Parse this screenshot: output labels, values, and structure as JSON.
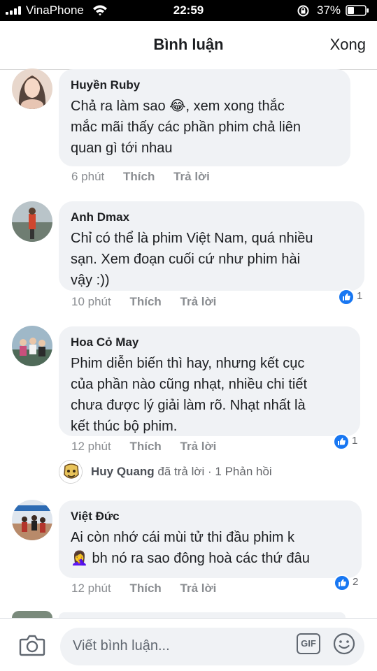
{
  "status_bar": {
    "carrier": "VinaPhone",
    "time": "22:59",
    "battery": "37%"
  },
  "header": {
    "title": "Bình luận",
    "done_label": "Xong"
  },
  "comments": [
    {
      "author": "Huyền Ruby",
      "text_before_emoji": "Chả ra làm sao ",
      "emoji": "😂",
      "text_after_emoji": ", xem xong thắc\nmắc mãi thấy các phần phim chả liên\nquan gì tới nhau",
      "time": "6 phút",
      "like_label": "Thích",
      "reply_label": "Trả lời"
    },
    {
      "author": "Anh Dmax",
      "text": "Chỉ có thể là phim Việt Nam, quá nhiều\nsạn. Xem đoạn cuối cứ như phim hài\nvậy :))",
      "time": "10 phút",
      "like_label": "Thích",
      "reply_label": "Trả lời",
      "reaction_count": "1"
    },
    {
      "author": "Hoa Cỏ May",
      "text": "Phim diễn biến thì hay, nhưng kết cục\ncủa phần nào cũng nhạt, nhiều chi tiết\nchưa được lý giải làm rõ. Nhạt nhất là\nkết thúc bộ phim.",
      "time": "12 phút",
      "like_label": "Thích",
      "reply_label": "Trả lời",
      "reaction_count": "1",
      "reply_summary": {
        "name": "Huy Quang",
        "text": " đã trả lời · 1 Phản hồi"
      }
    },
    {
      "author": "Việt Đức",
      "text_line1": "Ai còn nhớ cái mùi tử thi đầu phim k",
      "emoji": "🤦‍♀️",
      "text_line2": " bh nó ra sao đông hoà các thứ đâu",
      "time": "12 phút",
      "like_label": "Thích",
      "reply_label": "Trả lời",
      "reaction_count": "2"
    }
  ],
  "composer": {
    "placeholder": "Viết bình luận...",
    "gif_label": "GIF"
  },
  "colors": {
    "bubble": "#f0f2f5",
    "like_blue": "#1877f2",
    "meta_gray": "#8a8d91"
  }
}
